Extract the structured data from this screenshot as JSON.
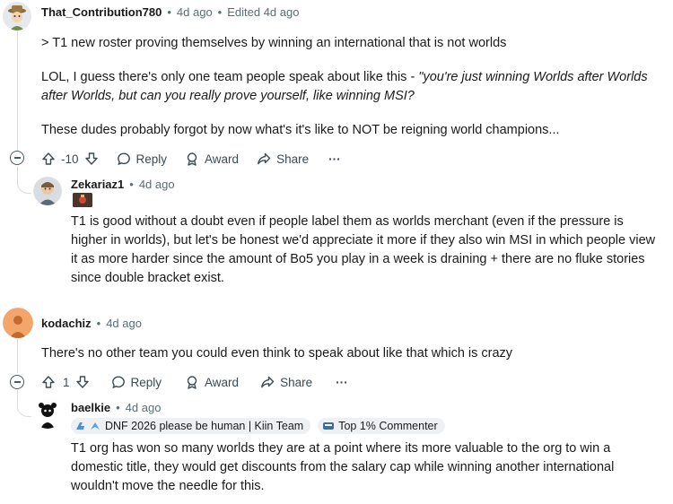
{
  "comments": [
    {
      "username": "That_Contribution780",
      "age": "4d ago",
      "edited": "Edited 4d ago",
      "quote": "> T1 new roster proving themselves by winning an international that is not worlds",
      "para1_plain": "LOL, I guess there's only one team people speak about like this - ",
      "para1_italic": "\"you're just winning Worlds after Worlds after Worlds, but can you really prove yourself, like winning MSI?",
      "para2": "These dudes probably forgot by now what's it's like to NOT be reigning world champions...",
      "score": "-10",
      "actions": {
        "reply": "Reply",
        "award": "Award",
        "share": "Share",
        "more": "···"
      }
    },
    {
      "username": "Zekariaz1",
      "age": "4d ago",
      "body": "T1 is good without a doubt even if people label them as worlds merchant (even if the pressure is higher in worlds), but let's be honest we'd appreciate it more if they also win MSI in which people view it as more harder since the amount of Bo5 you play in a week is draining + there are no fluke stories since double bracket exist."
    },
    {
      "username": "kodachiz",
      "age": "4d ago",
      "body": "There's no other team you could even think to speak about like that which is crazy",
      "score": "1",
      "actions": {
        "reply": "Reply",
        "award": "Award",
        "share": "Share",
        "more": "···"
      }
    },
    {
      "username": "baelkie",
      "age": "4d ago",
      "flair": "DNF 2026 please be human | Kiin Team",
      "badge": "Top 1% Commenter",
      "body": "T1 org has won so many worlds they are at a point where its more valuable to the org to win a domestic title, they would get discounts from the salary cap while winning another international wouldn't move the needle for this."
    }
  ],
  "colors": {
    "text": "#1a1a1b",
    "meta": "#576f76",
    "thread": "#d8dde0",
    "kodachiz_avatar": "#f2a66b"
  }
}
